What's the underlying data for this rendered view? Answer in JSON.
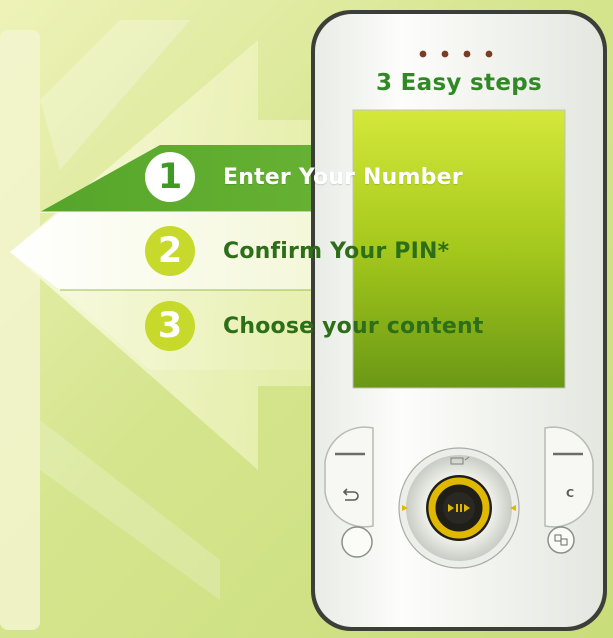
{
  "heading": "3 Easy steps",
  "steps": [
    {
      "number": "1",
      "label": "Enter Your Number"
    },
    {
      "number": "2",
      "label": "Confirm Your PIN*"
    },
    {
      "number": "3",
      "label": "Choose your content"
    }
  ],
  "colors": {
    "background": "#d8e89a",
    "arrow_dark_green": "#3e9a22",
    "text_green": "#2d6f19",
    "heading_green": "#2f8a24",
    "step_badge": "#c7d92a",
    "phone_body": "#f6f7f3",
    "nav_ring": "#e0b800"
  },
  "icons": [
    "back-arrow-icon",
    "clear-c-icon",
    "media-play-icon",
    "menu-grid-icon",
    "speaker-dots-icon"
  ]
}
